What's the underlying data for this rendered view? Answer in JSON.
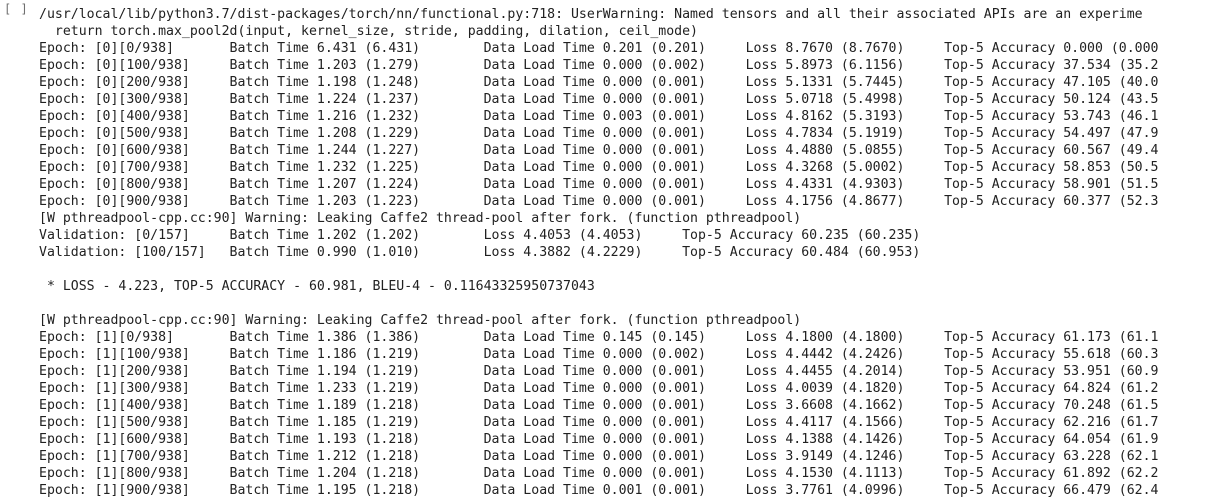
{
  "cell": {
    "run_indicator": "[ ]"
  },
  "output_lines": [
    "/usr/local/lib/python3.7/dist-packages/torch/nn/functional.py:718: UserWarning: Named tensors and all their associated APIs are an experime",
    "  return torch.max_pool2d(input, kernel_size, stride, padding, dilation, ceil_mode)",
    "Epoch: [0][0/938]       Batch Time 6.431 (6.431)        Data Load Time 0.201 (0.201)     Loss 8.7670 (8.7670)     Top-5 Accuracy 0.000 (0.000",
    "Epoch: [0][100/938]     Batch Time 1.203 (1.279)        Data Load Time 0.000 (0.002)     Loss 5.8973 (6.1156)     Top-5 Accuracy 37.534 (35.2",
    "Epoch: [0][200/938]     Batch Time 1.198 (1.248)        Data Load Time 0.000 (0.001)     Loss 5.1331 (5.7445)     Top-5 Accuracy 47.105 (40.0",
    "Epoch: [0][300/938]     Batch Time 1.224 (1.237)        Data Load Time 0.000 (0.001)     Loss 5.0718 (5.4998)     Top-5 Accuracy 50.124 (43.5",
    "Epoch: [0][400/938]     Batch Time 1.216 (1.232)        Data Load Time 0.003 (0.001)     Loss 4.8162 (5.3193)     Top-5 Accuracy 53.743 (46.1",
    "Epoch: [0][500/938]     Batch Time 1.208 (1.229)        Data Load Time 0.000 (0.001)     Loss 4.7834 (5.1919)     Top-5 Accuracy 54.497 (47.9",
    "Epoch: [0][600/938]     Batch Time 1.244 (1.227)        Data Load Time 0.000 (0.001)     Loss 4.4880 (5.0855)     Top-5 Accuracy 60.567 (49.4",
    "Epoch: [0][700/938]     Batch Time 1.232 (1.225)        Data Load Time 0.000 (0.001)     Loss 4.3268 (5.0002)     Top-5 Accuracy 58.853 (50.5",
    "Epoch: [0][800/938]     Batch Time 1.207 (1.224)        Data Load Time 0.000 (0.001)     Loss 4.4331 (4.9303)     Top-5 Accuracy 58.901 (51.5",
    "Epoch: [0][900/938]     Batch Time 1.203 (1.223)        Data Load Time 0.000 (0.001)     Loss 4.1756 (4.8677)     Top-5 Accuracy 60.377 (52.3",
    "[W pthreadpool-cpp.cc:90] Warning: Leaking Caffe2 thread-pool after fork. (function pthreadpool)",
    "Validation: [0/157]     Batch Time 1.202 (1.202)        Loss 4.4053 (4.4053)     Top-5 Accuracy 60.235 (60.235)",
    "Validation: [100/157]   Batch Time 0.990 (1.010)        Loss 4.3882 (4.2229)     Top-5 Accuracy 60.484 (60.953)",
    "",
    " * LOSS - 4.223, TOP-5 ACCURACY - 60.981, BLEU-4 - 0.11643325950737043",
    "",
    "[W pthreadpool-cpp.cc:90] Warning: Leaking Caffe2 thread-pool after fork. (function pthreadpool)",
    "Epoch: [1][0/938]       Batch Time 1.386 (1.386)        Data Load Time 0.145 (0.145)     Loss 4.1800 (4.1800)     Top-5 Accuracy 61.173 (61.1",
    "Epoch: [1][100/938]     Batch Time 1.186 (1.219)        Data Load Time 0.000 (0.002)     Loss 4.4442 (4.2426)     Top-5 Accuracy 55.618 (60.3",
    "Epoch: [1][200/938]     Batch Time 1.194 (1.219)        Data Load Time 0.000 (0.001)     Loss 4.4455 (4.2014)     Top-5 Accuracy 53.951 (60.9",
    "Epoch: [1][300/938]     Batch Time 1.233 (1.219)        Data Load Time 0.000 (0.001)     Loss 4.0039 (4.1820)     Top-5 Accuracy 64.824 (61.2",
    "Epoch: [1][400/938]     Batch Time 1.189 (1.218)        Data Load Time 0.000 (0.001)     Loss 3.6608 (4.1662)     Top-5 Accuracy 70.248 (61.5",
    "Epoch: [1][500/938]     Batch Time 1.185 (1.219)        Data Load Time 0.000 (0.001)     Loss 4.4117 (4.1566)     Top-5 Accuracy 62.216 (61.7",
    "Epoch: [1][600/938]     Batch Time 1.193 (1.218)        Data Load Time 0.000 (0.001)     Loss 4.1388 (4.1426)     Top-5 Accuracy 64.054 (61.9",
    "Epoch: [1][700/938]     Batch Time 1.212 (1.218)        Data Load Time 0.000 (0.001)     Loss 3.9149 (4.1246)     Top-5 Accuracy 63.228 (62.1",
    "Epoch: [1][800/938]     Batch Time 1.204 (1.218)        Data Load Time 0.000 (0.001)     Loss 4.1530 (4.1113)     Top-5 Accuracy 61.892 (62.2",
    "Epoch: [1][900/938]     Batch Time 1.195 (1.218)        Data Load Time 0.001 (0.001)     Loss 3.7761 (4.0996)     Top-5 Accuracy 66.479 (62.4"
  ]
}
